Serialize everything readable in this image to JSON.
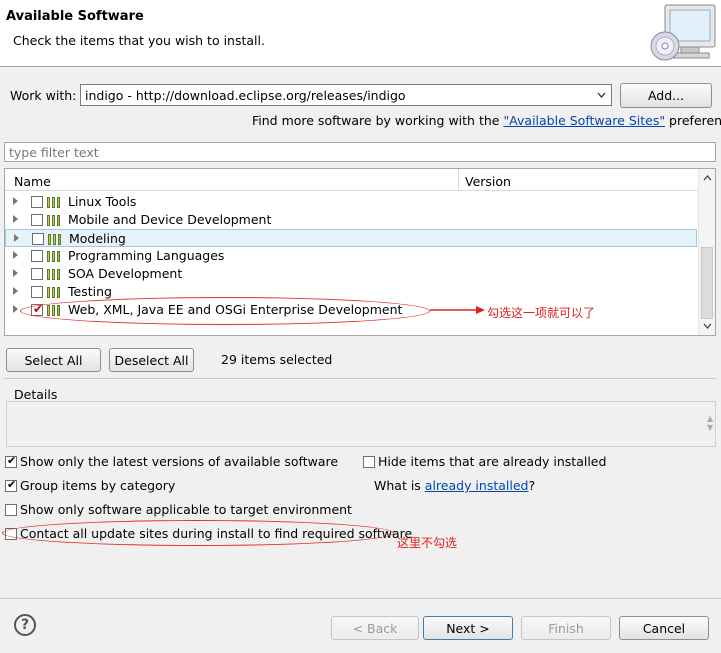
{
  "header": {
    "title": "Available Software",
    "subtitle": "Check the items that you wish to install.",
    "icon": "cd-monitor-icon"
  },
  "work_with": {
    "label": "Work with:",
    "value": "indigo - http://download.eclipse.org/releases/indigo",
    "add_label": "Add...",
    "find_more_prefix": "Find more software by working with the ",
    "find_more_link": "\"Available Software Sites\"",
    "find_more_suffix": " preferences."
  },
  "filter": {
    "placeholder": "type filter text"
  },
  "tree": {
    "columns": {
      "name": "Name",
      "version": "Version"
    },
    "items": [
      {
        "label": "Linux Tools",
        "checked": false,
        "selected": false
      },
      {
        "label": "Mobile and Device Development",
        "checked": false,
        "selected": false
      },
      {
        "label": "Modeling",
        "checked": false,
        "selected": true
      },
      {
        "label": "Programming Languages",
        "checked": false,
        "selected": false
      },
      {
        "label": "SOA Development",
        "checked": false,
        "selected": false
      },
      {
        "label": "Testing",
        "checked": false,
        "selected": false
      },
      {
        "label": "Web, XML, Java EE and OSGi Enterprise Development",
        "checked": true,
        "selected": false
      }
    ]
  },
  "annotations": {
    "select_note": "勾选这一项就可以了",
    "unselect_note": "这里不勾选",
    "color": "#e02020"
  },
  "selection": {
    "select_all": "Select All",
    "deselect_all": "Deselect All",
    "count_text": "29 items selected"
  },
  "details": {
    "label": "Details"
  },
  "options": {
    "latest_versions": {
      "label": "Show only the latest versions of available software",
      "checked": true
    },
    "group_by_category": {
      "label": "Group items by category",
      "checked": true
    },
    "target_env": {
      "label": "Show only software applicable to target environment",
      "checked": false
    },
    "contact_sites": {
      "label": "Contact all update sites during install to find required software",
      "checked": false
    },
    "hide_installed": {
      "label": "Hide items that are already installed",
      "checked": false
    },
    "what_is_prefix": "What is ",
    "what_is_link": "already installed",
    "what_is_suffix": "?"
  },
  "footer": {
    "help_icon": "question-icon",
    "back": "< Back",
    "next": "Next >",
    "finish": "Finish",
    "cancel": "Cancel"
  }
}
